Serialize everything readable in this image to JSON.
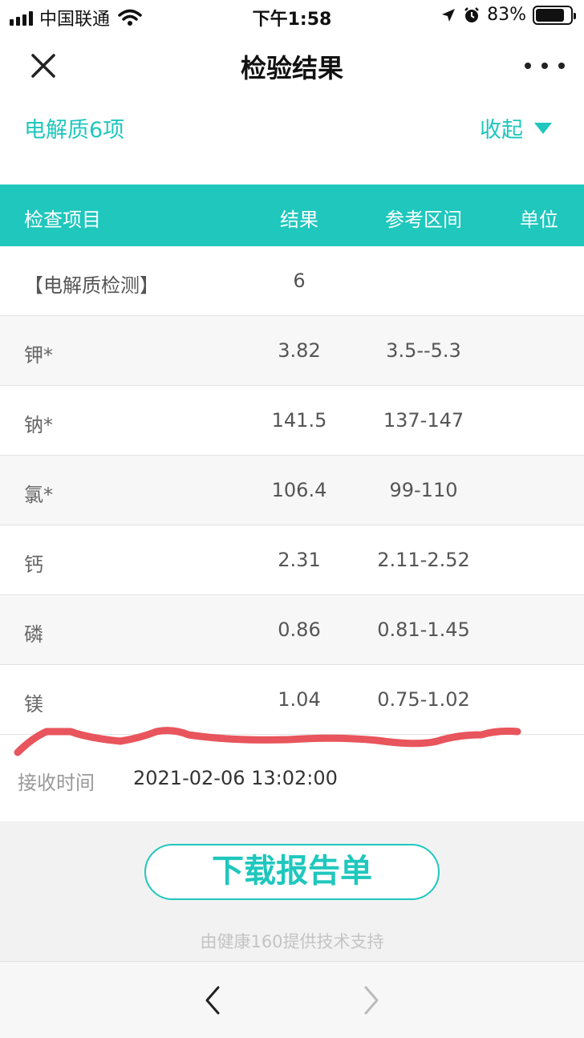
{
  "status_bar": {
    "carrier": "中国联通",
    "time": "下午1:58",
    "battery": "83%",
    "battery_level": 0.83,
    "icons": [
      "signal-icon",
      "wifi-icon",
      "location-icon",
      "alarm-icon",
      "battery-icon"
    ]
  },
  "nav": {
    "title": "检验结果",
    "close_icon": "close-icon",
    "more_icon": "more-icon"
  },
  "section": {
    "title": "电解质6项",
    "toggle_label": "收起"
  },
  "table": {
    "headers": {
      "item": "检查项目",
      "result": "结果",
      "range": "参考区间",
      "unit": "单位"
    },
    "rows": [
      {
        "name": "【电解质检测】",
        "result": "6",
        "range": "",
        "unit": ""
      },
      {
        "name": "钾*",
        "result": "3.82",
        "range": "3.5--5.3",
        "unit": ""
      },
      {
        "name": "钠*",
        "result": "141.5",
        "range": "137-147",
        "unit": ""
      },
      {
        "name": "氯*",
        "result": "106.4",
        "range": "99-110",
        "unit": ""
      },
      {
        "name": "钙",
        "result": "2.31",
        "range": "2.11-2.52",
        "unit": ""
      },
      {
        "name": "磷",
        "result": "0.86",
        "range": "0.81-1.45",
        "unit": ""
      },
      {
        "name": "镁",
        "result": "1.04",
        "range": "0.75-1.02",
        "unit": ""
      }
    ]
  },
  "receive": {
    "label": "接收时间",
    "value": "2021-02-06 13:02:00"
  },
  "download": {
    "label": "下载报告单"
  },
  "footer": {
    "support": "由健康160提供技术支持"
  },
  "colors": {
    "accent": "#1fc7bd",
    "annotation": "#e8555c"
  }
}
